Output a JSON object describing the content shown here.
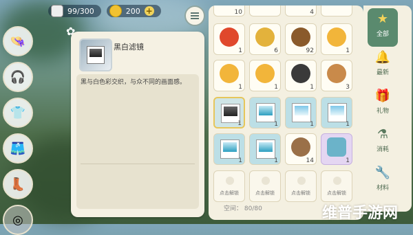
{
  "status": {
    "bag_count": "99/300",
    "coins": "200"
  },
  "selected_item": {
    "name": "黑白滤镜",
    "description": "黑与白色彩交织，与众不同的画面感。"
  },
  "left_buttons": [
    "hat-icon",
    "headphones-icon",
    "outfit-icon",
    "skirt-icon",
    "boots-icon",
    "more-icon"
  ],
  "inventory": {
    "cells": [
      {
        "row": 0,
        "col": 0,
        "count": "10",
        "kind": "partial"
      },
      {
        "row": 0,
        "col": 1,
        "count": "",
        "kind": "partial"
      },
      {
        "row": 0,
        "col": 2,
        "count": "4",
        "kind": "partial"
      },
      {
        "row": 0,
        "col": 3,
        "count": "",
        "kind": "partial"
      },
      {
        "row": 1,
        "col": 0,
        "count": "1",
        "kind": "tomato-icon",
        "color": "#e0482c"
      },
      {
        "row": 1,
        "col": 1,
        "count": "6",
        "kind": "wheat-icon",
        "color": "#e3b23c"
      },
      {
        "row": 1,
        "col": 2,
        "count": "92",
        "kind": "wood-icon",
        "color": "#8a5a2b"
      },
      {
        "row": 1,
        "col": 3,
        "count": "1",
        "kind": "chicken-icon",
        "color": "#f2b53a"
      },
      {
        "row": 2,
        "col": 0,
        "count": "1",
        "kind": "chicken-icon",
        "color": "#f2b53a"
      },
      {
        "row": 2,
        "col": 1,
        "count": "1",
        "kind": "chicken-icon",
        "color": "#f2b53a"
      },
      {
        "row": 2,
        "col": 2,
        "count": "1",
        "kind": "pot-icon",
        "color": "#3a3a3a"
      },
      {
        "row": 2,
        "col": 3,
        "count": "3",
        "kind": "bread-icon",
        "color": "#c98a4a"
      },
      {
        "row": 3,
        "col": 0,
        "count": "1",
        "kind": "filter-bw",
        "selected": true
      },
      {
        "row": 3,
        "col": 1,
        "count": "1",
        "kind": "filter-sea"
      },
      {
        "row": 3,
        "col": 2,
        "count": "1",
        "kind": "filter-sky"
      },
      {
        "row": 3,
        "col": 3,
        "count": "1",
        "kind": "filter-sky"
      },
      {
        "row": 4,
        "col": 0,
        "count": "1",
        "kind": "filter-sea"
      },
      {
        "row": 4,
        "col": 1,
        "count": "1",
        "kind": "filter-sea"
      },
      {
        "row": 4,
        "col": 2,
        "count": "14",
        "kind": "sign-icon",
        "color": "#9a7048"
      },
      {
        "row": 4,
        "col": 3,
        "count": "1",
        "kind": "stamp-icon",
        "purple": true
      },
      {
        "row": 5,
        "col": 0,
        "kind": "locked"
      },
      {
        "row": 5,
        "col": 1,
        "kind": "locked"
      },
      {
        "row": 5,
        "col": 2,
        "kind": "locked"
      },
      {
        "row": 5,
        "col": 3,
        "kind": "locked"
      }
    ],
    "locked_label": "点击解锁",
    "space_label": "空间：",
    "space_value": "80/80"
  },
  "tabs": [
    {
      "label": "全部",
      "icon": "star-icon",
      "active": true
    },
    {
      "label": "最新",
      "icon": "bell-icon"
    },
    {
      "label": "礼物",
      "icon": "gift-icon"
    },
    {
      "label": "消耗",
      "icon": "potion-icon"
    },
    {
      "label": "材料",
      "icon": "tools-icon"
    }
  ],
  "watermark": "维普手游网"
}
